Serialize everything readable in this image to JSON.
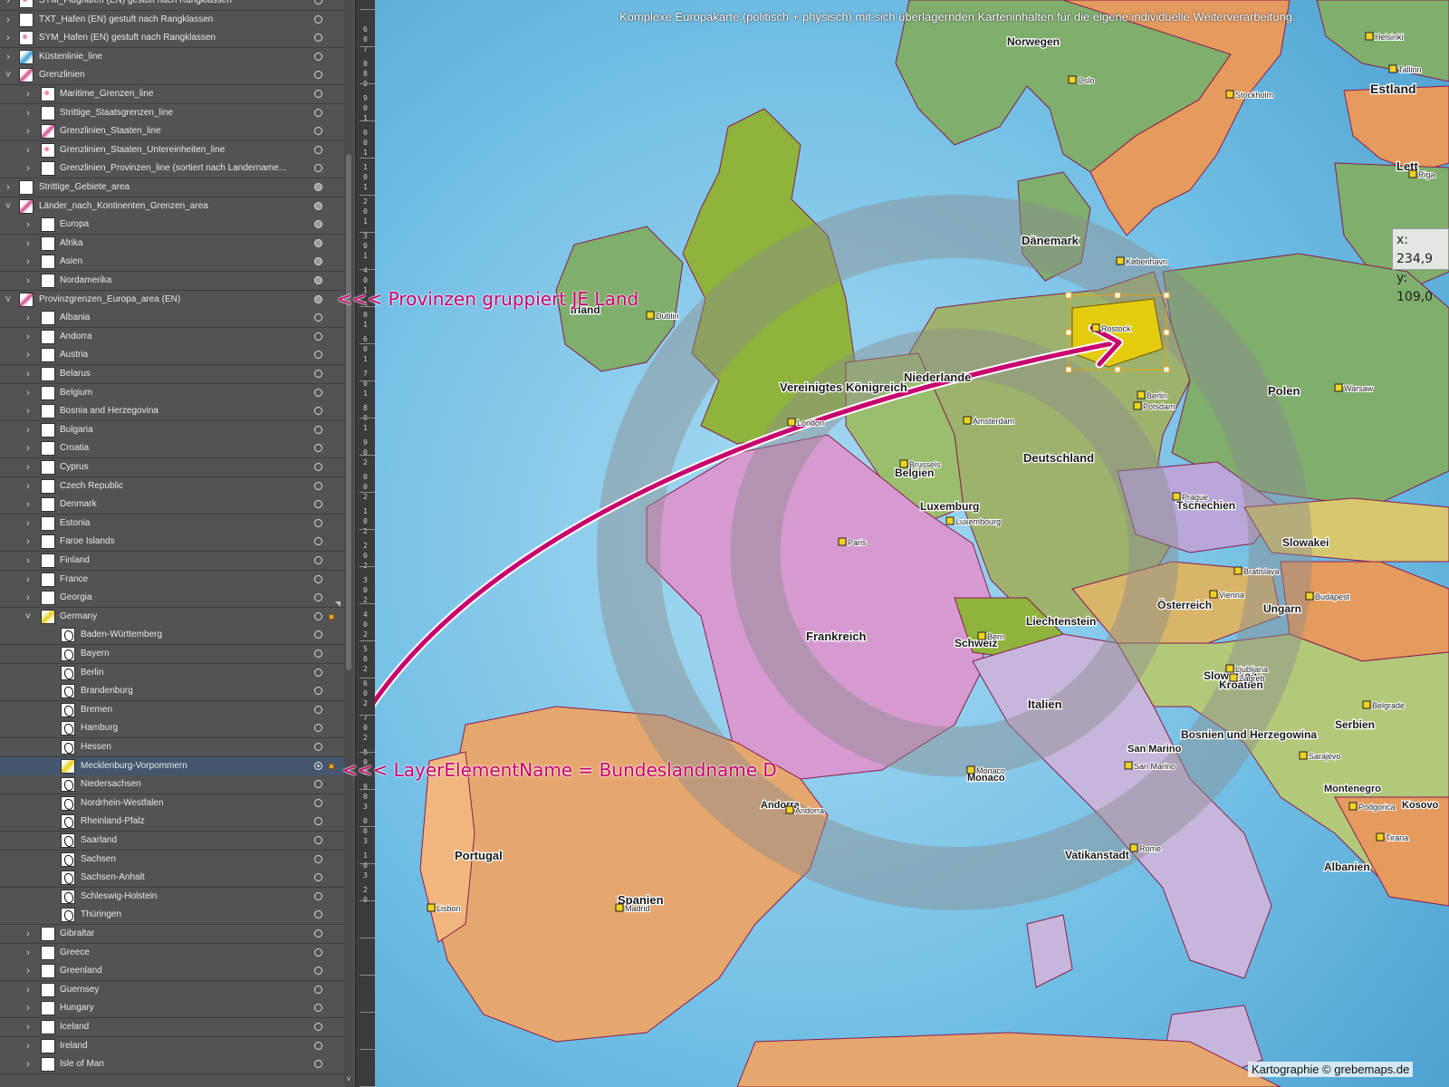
{
  "layers_panel": {
    "rows": [
      {
        "name": "SYM_Flughafen (EN) gestuft nach Rangklassen",
        "level": 0,
        "thumb": "dots",
        "vis": "hollow",
        "chevron": "right"
      },
      {
        "name": "TXT_Hafen (EN) gestuft nach Rangklassen",
        "level": 0,
        "thumb": "white",
        "vis": "hollow",
        "chevron": "right"
      },
      {
        "name": "SYM_Hafen (EN) gestuft nach Rangklassen",
        "level": 0,
        "thumb": "dots",
        "vis": "hollow",
        "chevron": "right"
      },
      {
        "name": "Küstenlinie_line",
        "level": 0,
        "thumb": "blue",
        "vis": "hollow",
        "chevron": "right"
      },
      {
        "name": "Grenzlinien",
        "level": 0,
        "thumb": "pink",
        "vis": "hollow",
        "chevron": "down"
      },
      {
        "name": "Maritime_Grenzen_line",
        "level": 1,
        "thumb": "dots",
        "vis": "hollow",
        "chevron": "right"
      },
      {
        "name": "Strittige_Staatsgrenzen_line",
        "level": 1,
        "thumb": "white",
        "vis": "hollow",
        "chevron": "right"
      },
      {
        "name": "Grenzlinien_Staaten_line",
        "level": 1,
        "thumb": "pink",
        "vis": "hollow",
        "chevron": "right"
      },
      {
        "name": "Grenzlinien_Staaten_Untereinheiten_line",
        "level": 1,
        "thumb": "dots",
        "vis": "hollow",
        "chevron": "right"
      },
      {
        "name": "Grenzlinien_Provinzen_line (sortiert nach Landername...",
        "level": 1,
        "thumb": "white",
        "vis": "hollow",
        "chevron": "right"
      },
      {
        "name": "Strittige_Gebiete_area",
        "level": 0,
        "thumb": "white",
        "vis": "filled",
        "chevron": "right"
      },
      {
        "name": "Länder_nach_Kontinenten_Grenzen_area",
        "level": 0,
        "thumb": "pink",
        "vis": "filled",
        "chevron": "down"
      },
      {
        "name": "Europa",
        "level": 1,
        "thumb": "white",
        "vis": "filled",
        "chevron": "right"
      },
      {
        "name": "Afrika",
        "level": 1,
        "thumb": "white",
        "vis": "filled",
        "chevron": "right"
      },
      {
        "name": "Asien",
        "level": 1,
        "thumb": "white",
        "vis": "filled",
        "chevron": "right"
      },
      {
        "name": "Nordamerika",
        "level": 1,
        "thumb": "white",
        "vis": "filled",
        "chevron": "right"
      },
      {
        "name": "Provinzgrenzen_Europa_area (EN)",
        "level": 0,
        "thumb": "pink",
        "vis": "filled",
        "chevron": "down"
      },
      {
        "name": "Albania",
        "level": 1,
        "thumb": "white",
        "vis": "hollow",
        "chevron": "right"
      },
      {
        "name": "Andorra",
        "level": 1,
        "thumb": "white",
        "vis": "hollow",
        "chevron": "right"
      },
      {
        "name": "Austria",
        "level": 1,
        "thumb": "white",
        "vis": "hollow",
        "chevron": "right"
      },
      {
        "name": "Belarus",
        "level": 1,
        "thumb": "white",
        "vis": "hollow",
        "chevron": "right"
      },
      {
        "name": "Belgium",
        "level": 1,
        "thumb": "white",
        "vis": "hollow",
        "chevron": "right"
      },
      {
        "name": "Bosnia and Herzegovina",
        "level": 1,
        "thumb": "white",
        "vis": "hollow",
        "chevron": "right"
      },
      {
        "name": "Bulgaria",
        "level": 1,
        "thumb": "white",
        "vis": "hollow",
        "chevron": "right"
      },
      {
        "name": "Croatia",
        "level": 1,
        "thumb": "white",
        "vis": "hollow",
        "chevron": "right"
      },
      {
        "name": "Cyprus",
        "level": 1,
        "thumb": "white",
        "vis": "hollow",
        "chevron": "right"
      },
      {
        "name": "Czech Republic",
        "level": 1,
        "thumb": "white",
        "vis": "hollow",
        "chevron": "right"
      },
      {
        "name": "Denmark",
        "level": 1,
        "thumb": "white",
        "vis": "hollow",
        "chevron": "right"
      },
      {
        "name": "Estonia",
        "level": 1,
        "thumb": "white",
        "vis": "hollow",
        "chevron": "right"
      },
      {
        "name": "Faroe Islands",
        "level": 1,
        "thumb": "white",
        "vis": "hollow",
        "chevron": "right"
      },
      {
        "name": "Finland",
        "level": 1,
        "thumb": "white",
        "vis": "hollow",
        "chevron": "right"
      },
      {
        "name": "France",
        "level": 1,
        "thumb": "white",
        "vis": "hollow",
        "chevron": "right"
      },
      {
        "name": "Georgia",
        "level": 1,
        "thumb": "white",
        "vis": "hollow",
        "chevron": "right"
      },
      {
        "name": "Germany",
        "level": 1,
        "thumb": "yellow",
        "vis": "hollow",
        "chevron": "down",
        "marker": true
      },
      {
        "name": "Baden-Württemberg",
        "level": 2,
        "thumb": "shape",
        "vis": "hollow",
        "chevron": "none"
      },
      {
        "name": "Bayern",
        "level": 2,
        "thumb": "shape",
        "vis": "hollow",
        "chevron": "none"
      },
      {
        "name": "Berlin",
        "level": 2,
        "thumb": "shape",
        "vis": "hollow",
        "chevron": "none"
      },
      {
        "name": "Brandenburg",
        "level": 2,
        "thumb": "shape",
        "vis": "hollow",
        "chevron": "none"
      },
      {
        "name": "Bremen",
        "level": 2,
        "thumb": "shape",
        "vis": "hollow",
        "chevron": "none"
      },
      {
        "name": "Hamburg",
        "level": 2,
        "thumb": "shape",
        "vis": "hollow",
        "chevron": "none"
      },
      {
        "name": "Hessen",
        "level": 2,
        "thumb": "shape",
        "vis": "hollow",
        "chevron": "none"
      },
      {
        "name": "Mecklenburg-Vorpommern",
        "level": 2,
        "thumb": "yellow",
        "vis": "target",
        "chevron": "none",
        "selected": true
      },
      {
        "name": "Niedersachsen",
        "level": 2,
        "thumb": "shape",
        "vis": "hollow",
        "chevron": "none"
      },
      {
        "name": "Nordrhein-Westfalen",
        "level": 2,
        "thumb": "shape",
        "vis": "hollow",
        "chevron": "none"
      },
      {
        "name": "Rheinland-Pfalz",
        "level": 2,
        "thumb": "shape",
        "vis": "hollow",
        "chevron": "none"
      },
      {
        "name": "Saarland",
        "level": 2,
        "thumb": "shape",
        "vis": "hollow",
        "chevron": "none"
      },
      {
        "name": "Sachsen",
        "level": 2,
        "thumb": "shape",
        "vis": "hollow",
        "chevron": "none"
      },
      {
        "name": "Sachsen-Anhalt",
        "level": 2,
        "thumb": "shape",
        "vis": "hollow",
        "chevron": "none"
      },
      {
        "name": "Schleswig-Holstein",
        "level": 2,
        "thumb": "shape",
        "vis": "hollow",
        "chevron": "none"
      },
      {
        "name": "Thüringen",
        "level": 2,
        "thumb": "shape",
        "vis": "hollow",
        "chevron": "none"
      },
      {
        "name": "Gibraltar",
        "level": 1,
        "thumb": "white",
        "vis": "hollow",
        "chevron": "right"
      },
      {
        "name": "Greece",
        "level": 1,
        "thumb": "white",
        "vis": "hollow",
        "chevron": "right"
      },
      {
        "name": "Greenland",
        "level": 1,
        "thumb": "white",
        "vis": "hollow",
        "chevron": "right"
      },
      {
        "name": "Guernsey",
        "level": 1,
        "thumb": "white",
        "vis": "hollow",
        "chevron": "right"
      },
      {
        "name": "Hungary",
        "level": 1,
        "thumb": "white",
        "vis": "hollow",
        "chevron": "right"
      },
      {
        "name": "Iceland",
        "level": 1,
        "thumb": "white",
        "vis": "hollow",
        "chevron": "right"
      },
      {
        "name": "Ireland",
        "level": 1,
        "thumb": "white",
        "vis": "hollow",
        "chevron": "right"
      },
      {
        "name": "Isle of Man",
        "level": 1,
        "thumb": "white",
        "vis": "hollow",
        "chevron": "right"
      }
    ]
  },
  "ruler": {
    "digits": [
      "6",
      "0",
      "7",
      "0",
      "8",
      "0",
      "9",
      "0",
      "1",
      "0",
      "0",
      "1",
      "1",
      "0",
      "1",
      "2",
      "0",
      "1",
      "3",
      "0",
      "1",
      "4",
      "0",
      "1",
      "5",
      "0",
      "1",
      "6",
      "0",
      "1",
      "7",
      "0",
      "1",
      "8",
      "0",
      "1",
      "9",
      "0",
      "2",
      "0",
      "0",
      "2",
      "1",
      "0",
      "2",
      "2",
      "0",
      "2",
      "3",
      "0",
      "2",
      "4",
      "0",
      "2",
      "5",
      "0",
      "2",
      "6",
      "0",
      "2",
      "7",
      "0",
      "2",
      "8",
      "0",
      "2",
      "9",
      "0",
      "3",
      "0",
      "0",
      "3",
      "1",
      "0",
      "3",
      "2",
      "0"
    ]
  },
  "map": {
    "caption": "Komplexe Europakarte (politisch + physisch) mit sich überlagernden Karteninhalten für die eigene individuelle Weiterverarbeitung.",
    "credit": "Kartographie © grebemaps.de",
    "coord_x": "x: 234,9",
    "coord_y": "y: 109,0",
    "callout_top": "<<< Provinzen gruppiert JE Land",
    "callout_bottom": "<<< LayerElementName = Bundeslandname D",
    "country_labels": [
      "Norwegen",
      "Estland",
      "Dänemark",
      "Lett",
      "Niederlande",
      "Vereinigtes Königreich",
      "Irland",
      "Polen",
      "Belgien",
      "Deutschland",
      "Luxemburg",
      "Tschechien",
      "Slowakei",
      "Frankreich",
      "Liechtenstein",
      "Schweiz",
      "Österreich",
      "Ungarn",
      "Slowenien",
      "Kroatien",
      "Italien",
      "Serbien",
      "Bosnien und Herzegowina",
      "San Marino",
      "Monaco",
      "Montenegro",
      "Andorra",
      "Portugal",
      "Spanien",
      "Vatikanstadt",
      "Albanien",
      "Kosovo"
    ],
    "city_labels": [
      "Oslo",
      "Stockholm",
      "København",
      "Helsinki",
      "Tallinn",
      "Riga",
      "Dublin",
      "London",
      "Paris",
      "Berlin",
      "Warsaw",
      "Prague",
      "Brussels",
      "Luxembourg",
      "Bern",
      "Vienna",
      "Bratislava",
      "Budapest",
      "Ljubljana",
      "Zagreb",
      "Belgrade",
      "Sarajevo",
      "Madrid",
      "Lisbon",
      "Rome",
      "Andorra",
      "Monaco",
      "San Marino",
      "Tirana",
      "Podgorica",
      "Amsterdam",
      "Potsdam",
      "Rostock"
    ],
    "colors": {
      "sea": "#5fb3dc",
      "accent": "#c8006e",
      "highlight": "#e3cc10"
    }
  }
}
